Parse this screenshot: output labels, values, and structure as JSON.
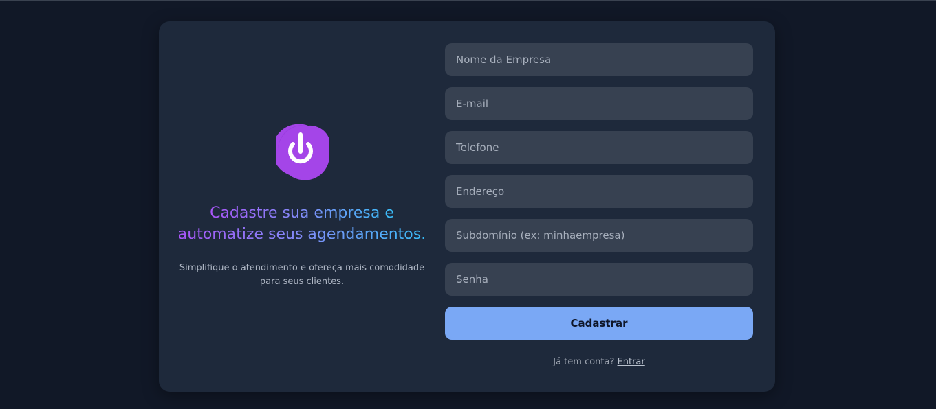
{
  "brand": {
    "logo_icon": "power-icon",
    "logo_color": "#a445e8",
    "headline_line1": "Cadastre sua empresa e",
    "headline_line2": "automatize seus agendamentos.",
    "subtitle": "Simplifique o atendimento e ofereça mais comodidade para seus clientes."
  },
  "form": {
    "company_name_placeholder": "Nome da Empresa",
    "email_placeholder": "E-mail",
    "phone_placeholder": "Telefone",
    "address_placeholder": "Endereço",
    "subdomain_placeholder": "Subdomínio (ex: minhaempresa)",
    "password_placeholder": "Senha",
    "submit_label": "Cadastrar"
  },
  "footer": {
    "login_prompt": "Já tem conta?",
    "login_link": "Entrar"
  },
  "colors": {
    "background": "#111827",
    "card": "#1e293b",
    "input": "#374151",
    "primary_button": "#7aa8f5",
    "gradient_start": "#a855f7",
    "gradient_end": "#38bdf8"
  }
}
